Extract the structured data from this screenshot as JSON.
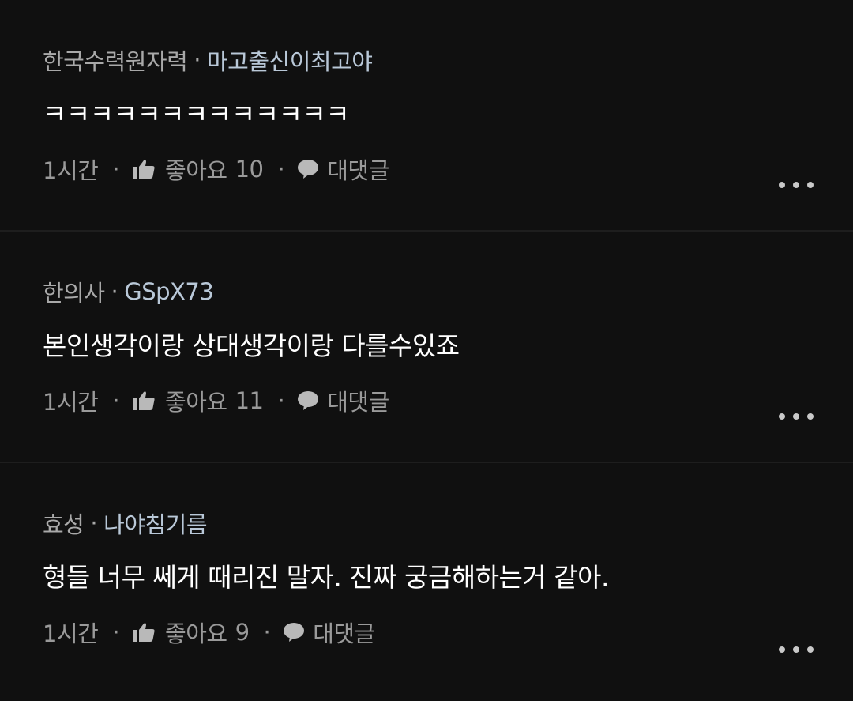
{
  "comments": [
    {
      "affiliation": "한국수력원자력",
      "separator": "·",
      "nickname": "마고출신이최고야",
      "text": "ㅋㅋㅋㅋㅋㅋㅋㅋㅋㅋㅋㅋㅋ",
      "time": "1시간",
      "likes_label": "좋아요",
      "likes_count": "10",
      "reply_label": "대댓글"
    },
    {
      "affiliation": "한의사",
      "separator": "·",
      "nickname": "GSpX73",
      "text": "본인생각이랑 상대생각이랑 다를수있죠",
      "time": "1시간",
      "likes_label": "좋아요",
      "likes_count": "11",
      "reply_label": "대댓글"
    },
    {
      "affiliation": "효성",
      "separator": "·",
      "nickname": "나야침기름",
      "text": "형들 너무 쎄게 때리진 말자. 진짜 궁금해하는거 같아.",
      "time": "1시간",
      "likes_label": "좋아요",
      "likes_count": "9",
      "reply_label": "대댓글"
    }
  ],
  "meta_separator": "·",
  "icons": {
    "like": "thumbs-up-icon",
    "reply": "speech-bubble-icon",
    "more": "more-horizontal-icon"
  },
  "colors": {
    "background": "#101010",
    "text": "#ffffff",
    "muted": "#9a9a9a",
    "nickname": "#b9c8d8"
  }
}
